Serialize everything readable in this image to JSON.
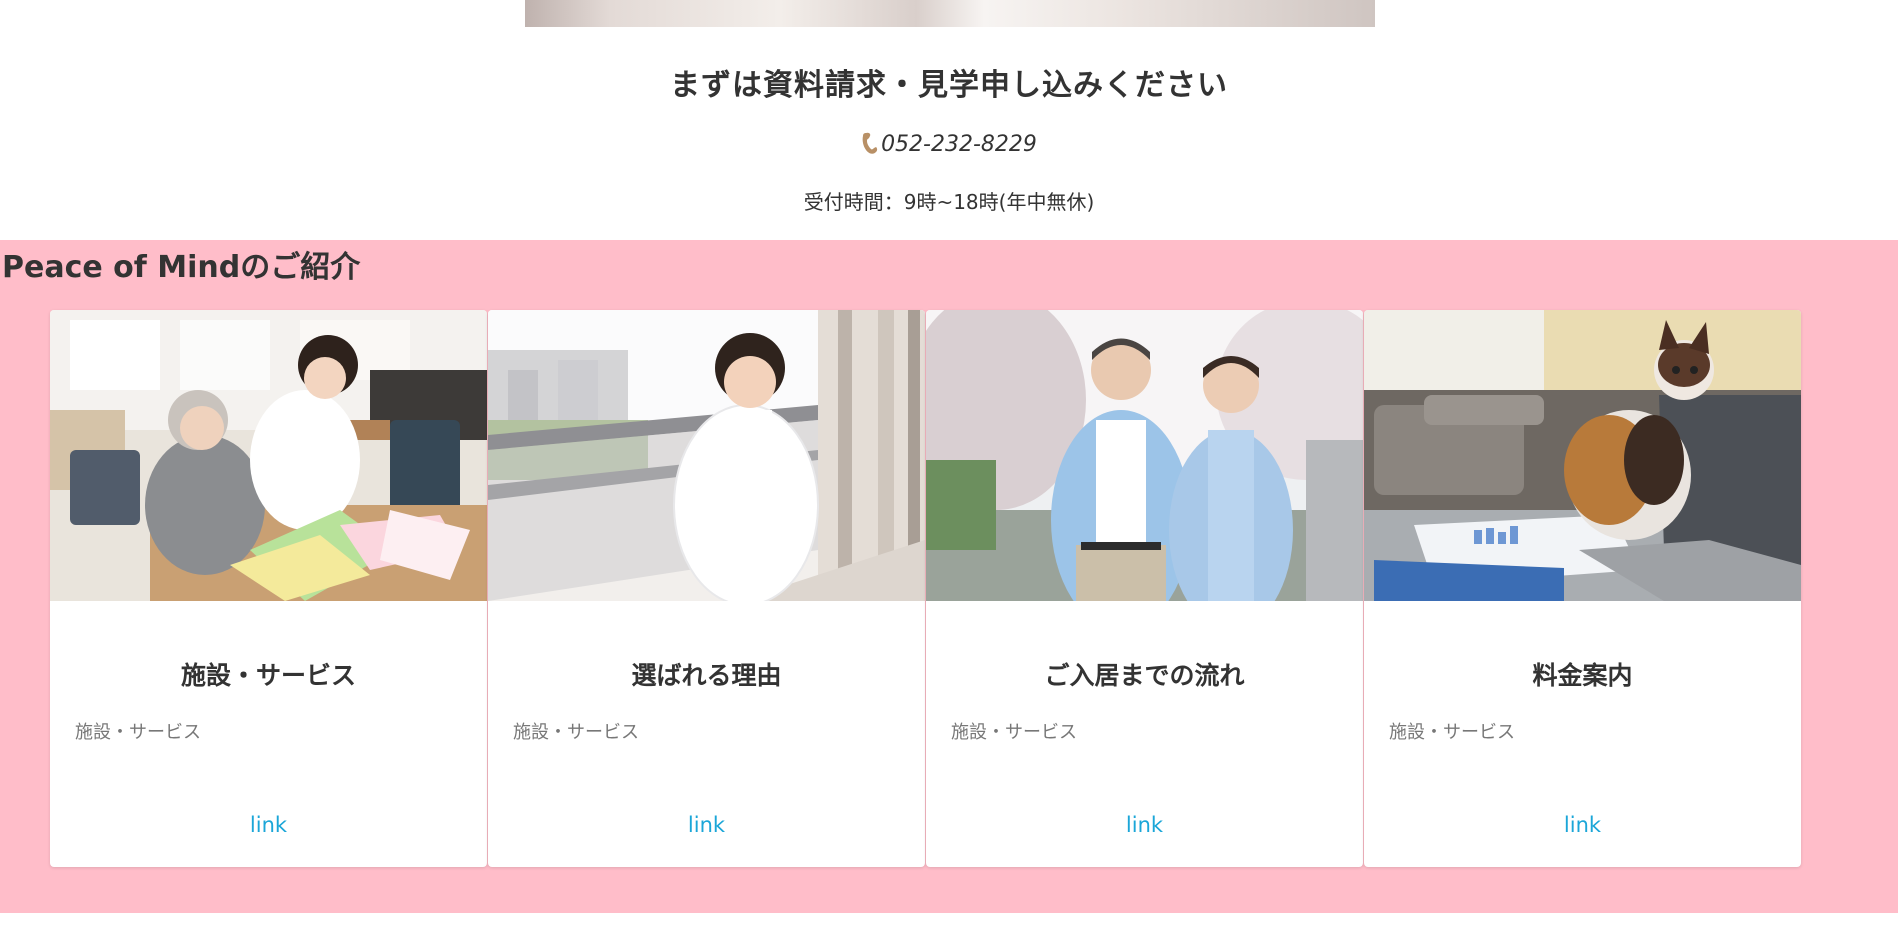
{
  "contact": {
    "title": "まずは資料請求・見学申し込みください",
    "phone_icon": "phone-icon",
    "phone": "052-232-8229",
    "hours": "受付時間：9時~18時(年中無休)"
  },
  "intro": {
    "title": "Peace of Mindのご紹介",
    "background_color": "#ffbdc9",
    "cards": [
      {
        "title": "施設・サービス",
        "text": "施設・サービス",
        "link": "link",
        "image": "caregiver-with-elderly-woman-photo"
      },
      {
        "title": "選ばれる理由",
        "text": "施設・サービス",
        "link": "link",
        "image": "smiling-staff-on-balcony-photo"
      },
      {
        "title": "ご入居までの流れ",
        "text": "施設・サービス",
        "link": "link",
        "image": "senior-couple-outdoors-photo"
      },
      {
        "title": "料金案内",
        "text": "施設・サービス",
        "link": "link",
        "image": "cat-on-desk-with-laptop-photo"
      }
    ]
  },
  "colors": {
    "link": "#1ba6d8",
    "text": "#333333"
  }
}
